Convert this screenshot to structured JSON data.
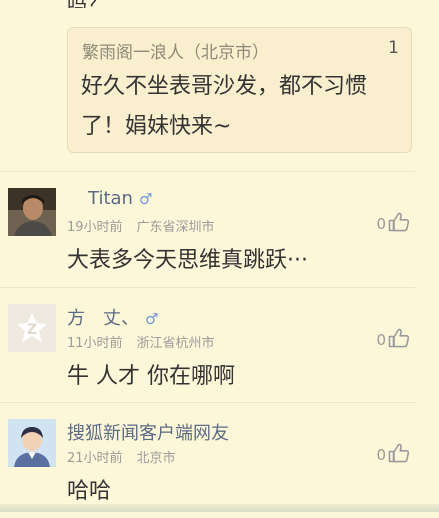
{
  "cut_top_text": "吗？",
  "quote": {
    "author": "繁雨阁一浪人（北京市）",
    "floor": "1",
    "text": "好久不坐表哥沙发，都不习惯了！娟妹快来~"
  },
  "comments": [
    {
      "name": "Titan",
      "gender_icon": "♂",
      "time": "19小时前",
      "location": "广东省深圳市",
      "likes": "0",
      "text": "大表多今天思维真跳跃···"
    },
    {
      "name": "方　丈、",
      "gender_icon": "♂",
      "time": "11小时前",
      "location": "浙江省杭州市",
      "likes": "0",
      "text": "牛 人才 你在哪啊"
    },
    {
      "name": "搜狐新闻客户端网友",
      "gender_icon": "",
      "time": "21小时前",
      "location": "北京市",
      "likes": "0",
      "text": "哈哈"
    }
  ],
  "colors": {
    "background": "#fdf7d9",
    "name": "#5c6b84",
    "gender": "#6f97d8",
    "meta": "#9b9b9b"
  }
}
